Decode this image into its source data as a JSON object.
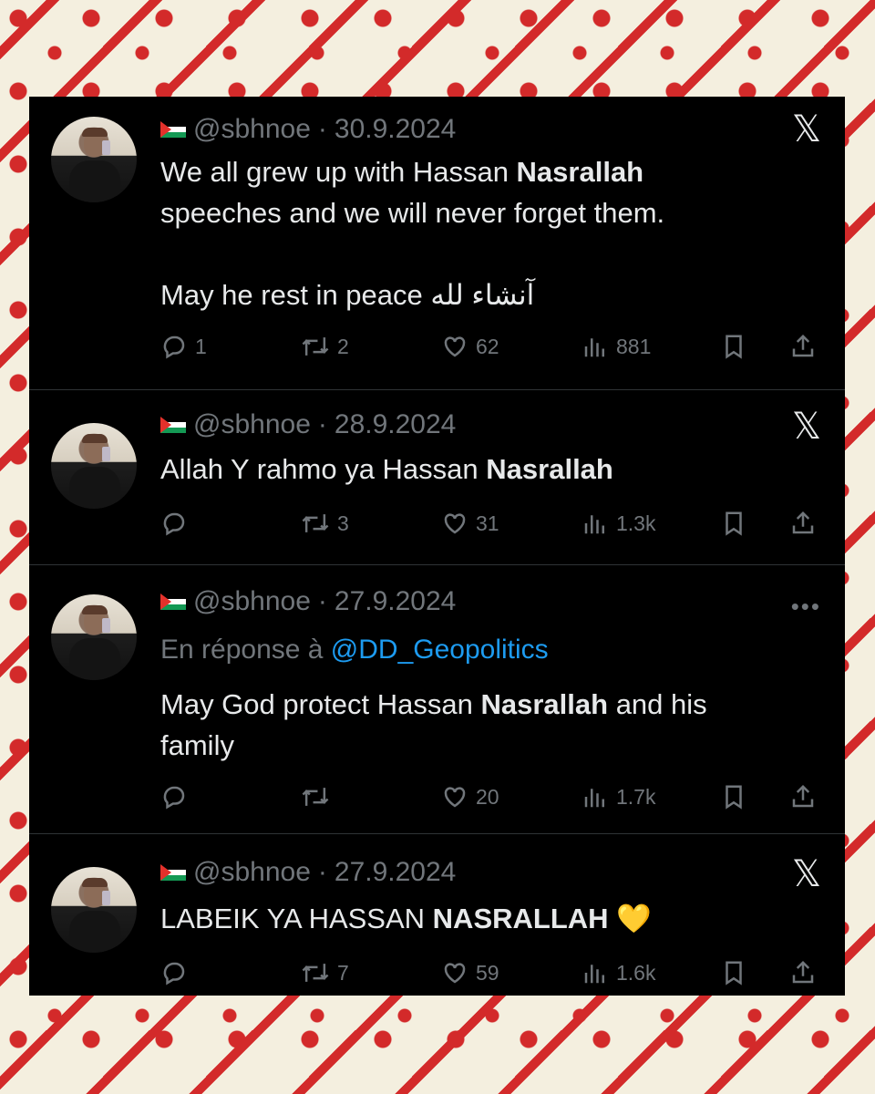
{
  "tweets": [
    {
      "handle": "@sbhnoe",
      "sep": "·",
      "date": "30.9.2024",
      "text_before": "We all grew up with Hassan ",
      "text_bold": "Nasrallah",
      "text_after": "\nspeeches and we will never forget them.\n\nMay he rest in peace آنشاء لله",
      "reply_prefix": "",
      "reply_mention": "",
      "replies": "1",
      "retweets": "2",
      "likes": "62",
      "views": "881",
      "corner": "x-logo"
    },
    {
      "handle": "@sbhnoe",
      "sep": "·",
      "date": "28.9.2024",
      "text_before": "Allah Y rahmo ya Hassan ",
      "text_bold": "Nasrallah",
      "text_after": "",
      "reply_prefix": "",
      "reply_mention": "",
      "replies": "",
      "retweets": "3",
      "likes": "31",
      "views": "1.3k",
      "corner": "x-logo"
    },
    {
      "handle": "@sbhnoe",
      "sep": "·",
      "date": "27.9.2024",
      "text_before": "May God protect Hassan ",
      "text_bold": "Nasrallah",
      "text_after": " and his\nfamily",
      "reply_prefix": "En réponse à ",
      "reply_mention": "@DD_Geopolitics",
      "replies": "",
      "retweets": "",
      "likes": "20",
      "views": "1.7k",
      "corner": "more-dots"
    },
    {
      "handle": "@sbhnoe",
      "sep": "·",
      "date": "27.9.2024",
      "text_before": "LABEIK YA HASSAN ",
      "text_bold": "NASRALLAH",
      "text_after": " 💛",
      "reply_prefix": "",
      "reply_mention": "",
      "replies": "",
      "retweets": "7",
      "likes": "59",
      "views": "1.6k",
      "corner": "x-logo"
    }
  ],
  "icons": {
    "x_logo": "𝕏",
    "more": "•••"
  },
  "colors": {
    "card_bg": "#000000",
    "text": "#e7e9ea",
    "muted": "#71767b",
    "link": "#1d9bf0",
    "pattern_red": "#d32a2a",
    "pattern_bg": "#f4efdf"
  }
}
